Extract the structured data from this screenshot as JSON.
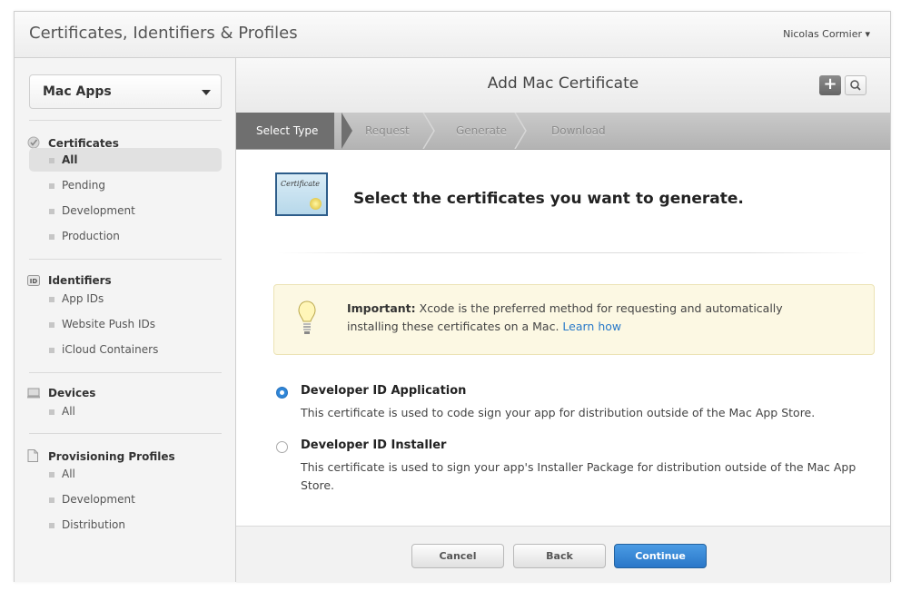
{
  "header": {
    "title": "Certificates, Identifiers & Profiles",
    "user": "Nicolas Cormier ▾"
  },
  "sidebar": {
    "platform": "Mac Apps",
    "sections": [
      {
        "title": "Certificates",
        "icon": "certificate-icon",
        "items": [
          "All",
          "Pending",
          "Development",
          "Production"
        ],
        "active_index": 0
      },
      {
        "title": "Identifiers",
        "icon": "id-icon",
        "items": [
          "App IDs",
          "Website Push IDs",
          "iCloud Containers"
        ]
      },
      {
        "title": "Devices",
        "icon": "device-icon",
        "items": [
          "All"
        ]
      },
      {
        "title": "Provisioning Profiles",
        "icon": "document-icon",
        "items": [
          "All",
          "Development",
          "Distribution"
        ]
      }
    ]
  },
  "main": {
    "title": "Add Mac Certificate",
    "add_label": "+",
    "steps": [
      "Select Type",
      "Request",
      "Generate",
      "Download"
    ],
    "active_step": 0,
    "cert_icon_text": "Certificate",
    "prompt": "Select the certificates you want to generate.",
    "notice": {
      "label": "Important:",
      "text": "Xcode is the preferred method for requesting and automatically installing these certificates on a Mac.",
      "link": "Learn how"
    },
    "options": [
      {
        "title": "Developer ID Application",
        "description": "This certificate is used to code sign your app for distribution outside of the Mac App Store.",
        "selected": true
      },
      {
        "title": "Developer ID Installer",
        "description": "This certificate is used to sign your app's Installer Package for distribution outside of the Mac App Store.",
        "selected": false
      }
    ],
    "buttons": {
      "cancel": "Cancel",
      "back": "Back",
      "continue": "Continue"
    }
  },
  "colors": {
    "accent": "#2a77c8",
    "link": "#2a7ac9",
    "notice_bg": "#fcf8e3",
    "active_step_bg": "#6f6f6f"
  }
}
